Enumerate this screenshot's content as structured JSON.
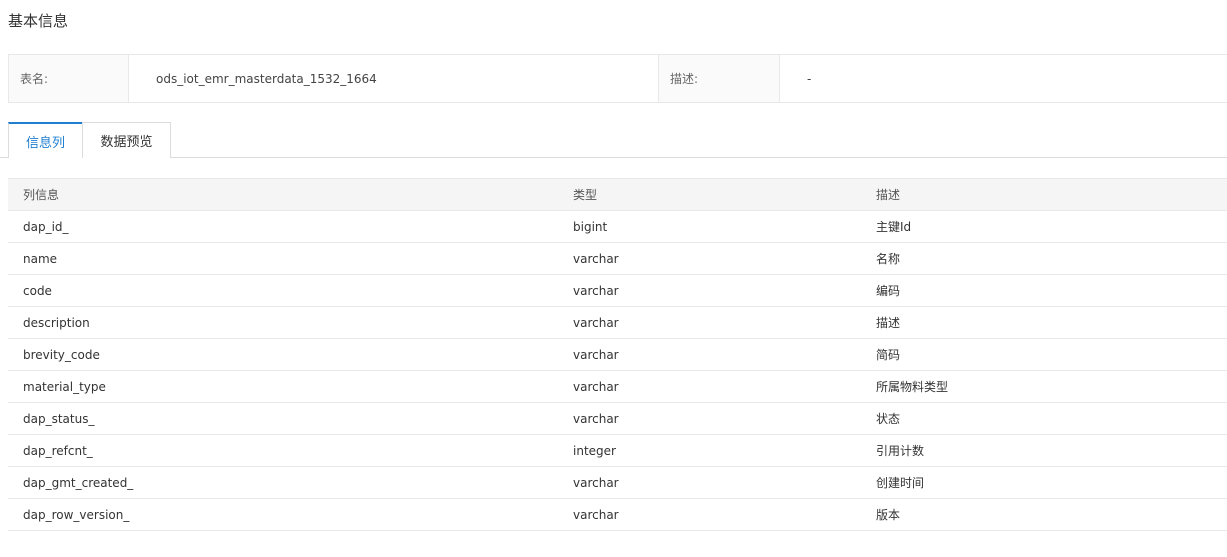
{
  "section": {
    "title": "基本信息"
  },
  "info": {
    "table_name_label": "表名:",
    "table_name_value": "ods_iot_emr_masterdata_1532_1664",
    "desc_label": "描述:",
    "desc_value": "-"
  },
  "tabs": [
    {
      "label": "信息列",
      "active": true
    },
    {
      "label": "数据预览",
      "active": false
    }
  ],
  "columns_table": {
    "headers": [
      "列信息",
      "类型",
      "描述"
    ],
    "rows": [
      [
        "dap_id_",
        "bigint",
        "主键Id"
      ],
      [
        "name",
        "varchar",
        "名称"
      ],
      [
        "code",
        "varchar",
        "编码"
      ],
      [
        "description",
        "varchar",
        "描述"
      ],
      [
        "brevity_code",
        "varchar",
        "简码"
      ],
      [
        "material_type",
        "varchar",
        "所属物料类型"
      ],
      [
        "dap_status_",
        "varchar",
        "状态"
      ],
      [
        "dap_refcnt_",
        "integer",
        "引用计数"
      ],
      [
        "dap_gmt_created_",
        "varchar",
        "创建时间"
      ],
      [
        "dap_row_version_",
        "varchar",
        "版本"
      ]
    ]
  },
  "colors": {
    "accent": "#1f7ed0",
    "border": "#e8e8e8",
    "header_bg": "#f5f5f5"
  }
}
